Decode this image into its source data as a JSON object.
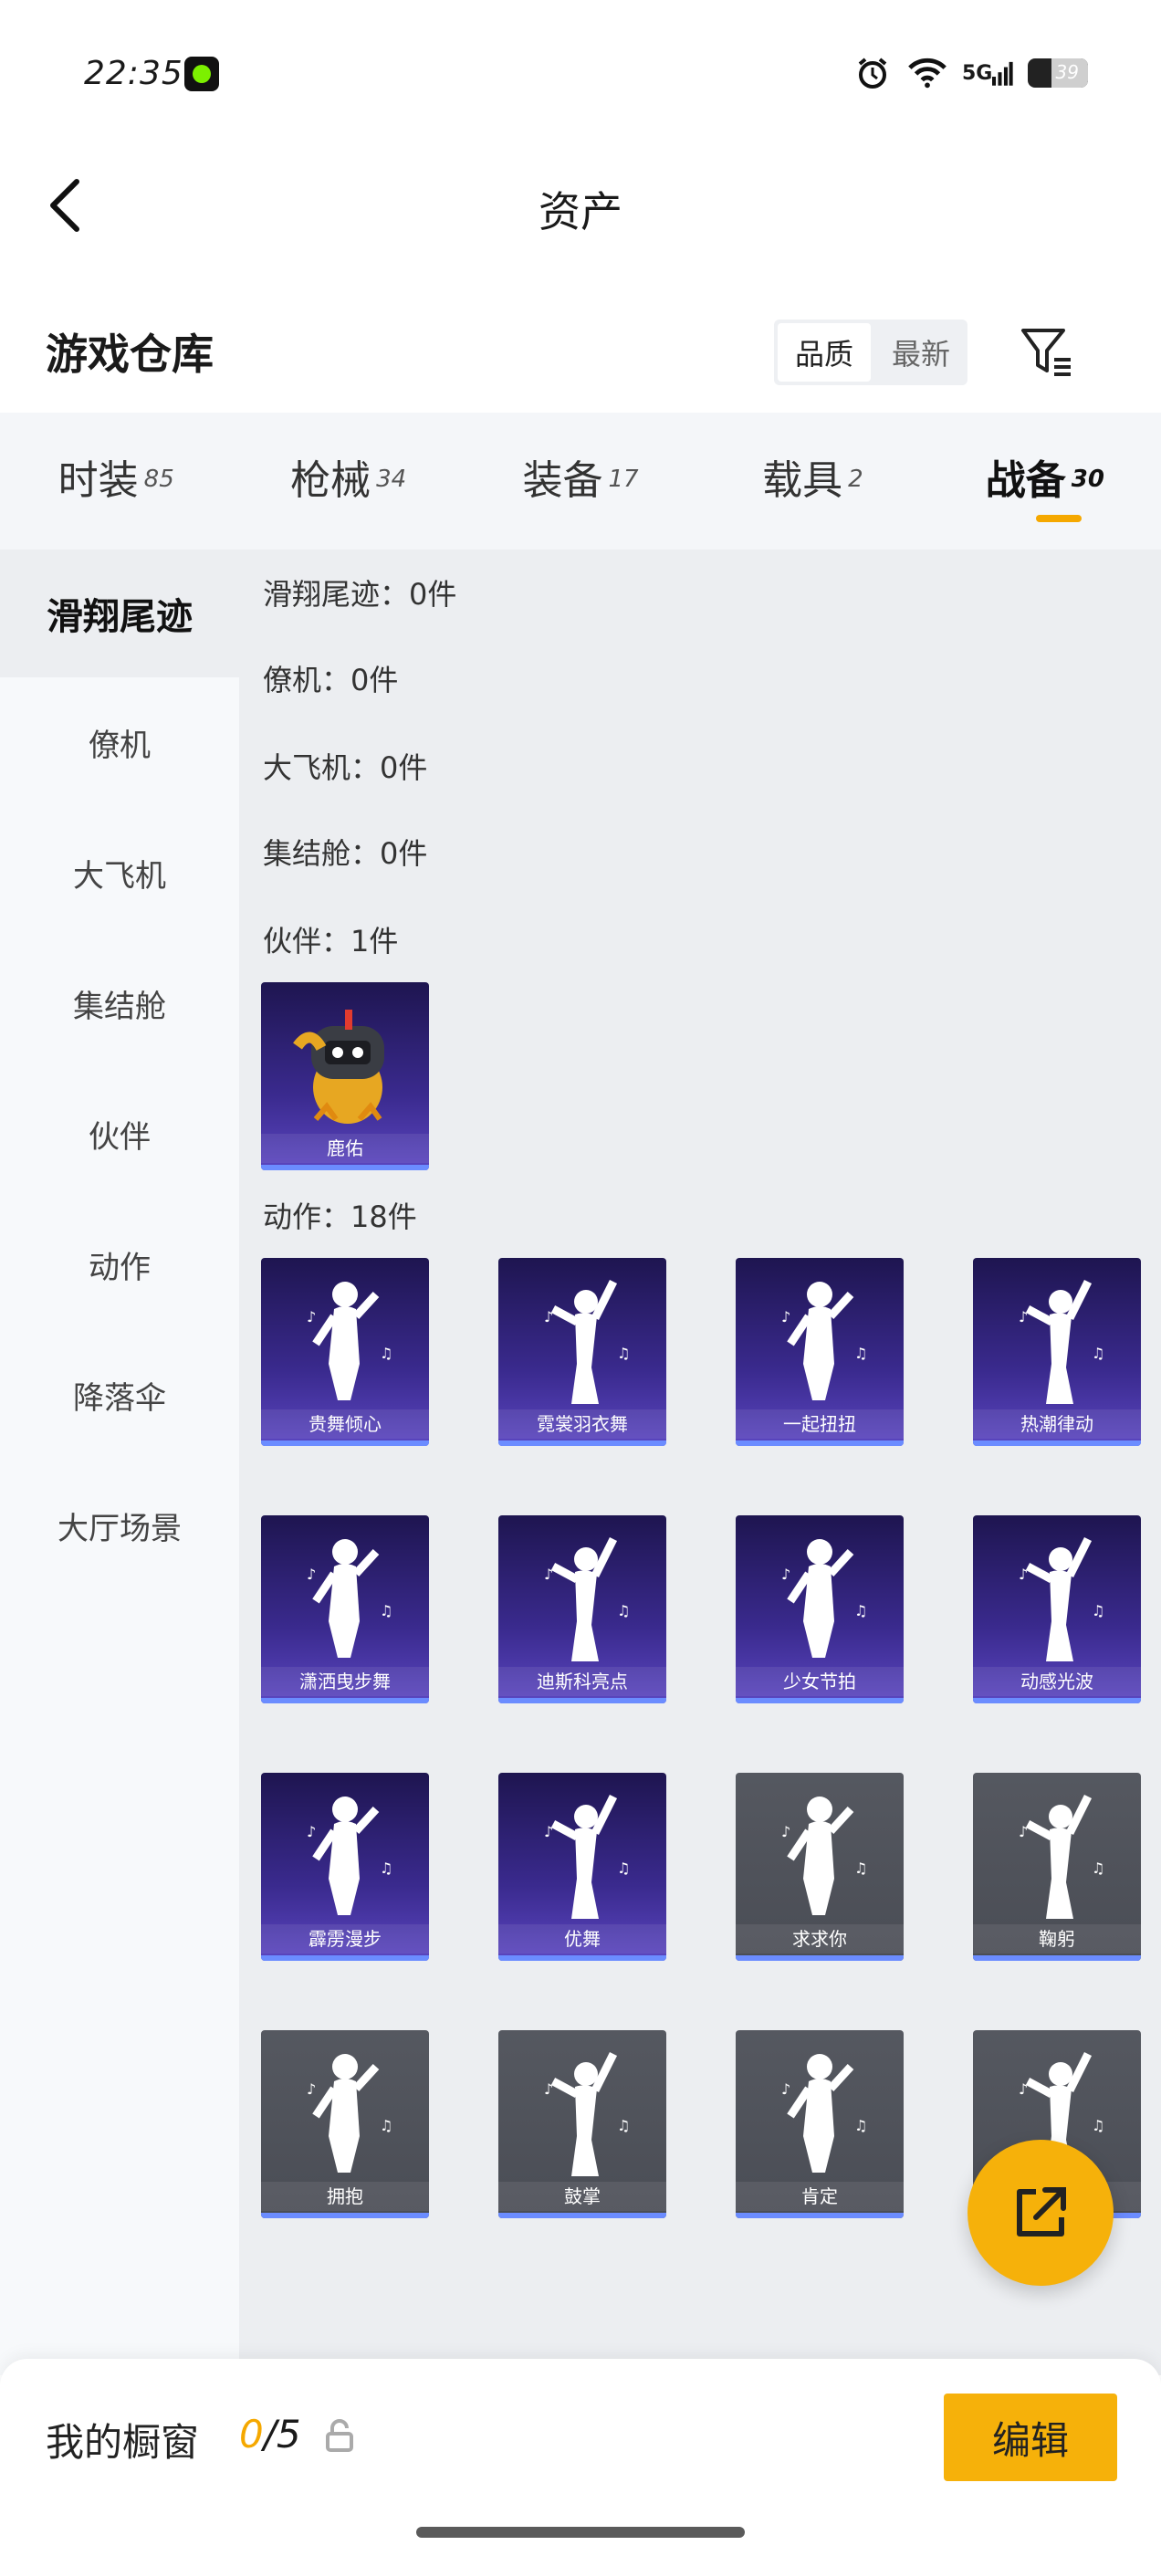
{
  "status": {
    "time": "22:35",
    "network": "5G",
    "battery": "39",
    "battery_level": 0.39
  },
  "nav": {
    "title": "资产"
  },
  "header": {
    "title": "游戏仓库",
    "sort": [
      "品质",
      "最新"
    ],
    "sort_active": 0
  },
  "tabs": [
    {
      "label": "时装",
      "count": "85"
    },
    {
      "label": "枪械",
      "count": "34"
    },
    {
      "label": "装备",
      "count": "17"
    },
    {
      "label": "载具",
      "count": "2"
    },
    {
      "label": "战备",
      "count": "30"
    }
  ],
  "sidebar": [
    {
      "label": "滑翔尾迹"
    },
    {
      "label": "僚机"
    },
    {
      "label": "大飞机"
    },
    {
      "label": "集结舱"
    },
    {
      "label": "伙伴"
    },
    {
      "label": "动作"
    },
    {
      "label": "降落伞"
    },
    {
      "label": "大厅场景"
    }
  ],
  "sections": {
    "trail": "滑翔尾迹：0件",
    "wingman": "僚机：0件",
    "plane": "大飞机：0件",
    "capsule": "集结舱：0件",
    "partner": "伙伴：1件",
    "emote": "动作：18件"
  },
  "partner_items": [
    {
      "name": "鹿佑"
    }
  ],
  "emote_items": [
    {
      "name": "贵舞倾心",
      "rarity": "purple"
    },
    {
      "name": "霓裳羽衣舞",
      "rarity": "purple"
    },
    {
      "name": "一起扭扭",
      "rarity": "purple"
    },
    {
      "name": "热潮律动",
      "rarity": "purple"
    },
    {
      "name": "潇洒曳步舞",
      "rarity": "purple"
    },
    {
      "name": "迪斯科亮点",
      "rarity": "purple"
    },
    {
      "name": "少女节拍",
      "rarity": "purple"
    },
    {
      "name": "动感光波",
      "rarity": "purple"
    },
    {
      "name": "霹雳漫步",
      "rarity": "purple"
    },
    {
      "name": "优舞",
      "rarity": "purple"
    },
    {
      "name": "求求你",
      "rarity": "gray"
    },
    {
      "name": "鞠躬",
      "rarity": "gray"
    },
    {
      "name": "拥抱",
      "rarity": "gray"
    },
    {
      "name": "鼓掌",
      "rarity": "gray"
    },
    {
      "name": "肯定",
      "rarity": "gray"
    },
    {
      "name": "",
      "rarity": "gray"
    }
  ],
  "bottom": {
    "title": "我的橱窗",
    "current": "0",
    "total": "/5",
    "edit_label": "编辑"
  },
  "colors": {
    "accent": "#f6b10a",
    "purple_card": "#3a2a8e",
    "gray_card": "#4a4d55"
  }
}
